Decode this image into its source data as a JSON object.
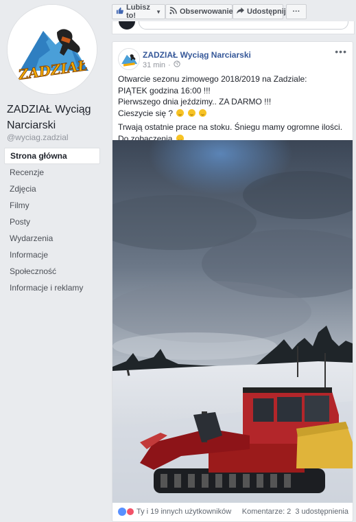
{
  "sidebar": {
    "page_name": "ZADZIAŁ Wyciąg Narciarski",
    "handle": "@wyciag.zadzial",
    "logo_text": "ZADZIAŁ",
    "items": [
      {
        "label": "Strona główna",
        "active": true
      },
      {
        "label": "Recenzje"
      },
      {
        "label": "Zdjęcia"
      },
      {
        "label": "Filmy"
      },
      {
        "label": "Posty"
      },
      {
        "label": "Wydarzenia"
      },
      {
        "label": "Informacje"
      },
      {
        "label": "Społeczność"
      },
      {
        "label": "Informacje i reklamy"
      }
    ]
  },
  "actionbar": {
    "like_label": "Lubisz to!",
    "follow_label": "Obserwowanie",
    "share_label": "Udostępnij",
    "more_label": "···"
  },
  "post": {
    "author": "ZADZIAŁ Wyciąg Narciarski",
    "time": "31 min",
    "lines": [
      "Otwarcie sezonu zimowego 2018/2019 na Zadziale:",
      "PIĄTEK godzina 16:00 !!!",
      "Pierwszego dnia jeździmy.. ZA DARMO !!!",
      "Cieszycie się ?"
    ],
    "second_paragraph": "Trwają ostatnie prace na stoku. Śniegu mamy ogromne ilości. Do zobaczenia",
    "reactions_text": "Ty i 19 innych użytkowników",
    "comments_text": "Komentarze: 2",
    "shares_text": "3 udostępnienia"
  },
  "colors": {
    "link": "#365899",
    "background": "#e9ebee",
    "like_blue": "#4267b2"
  }
}
